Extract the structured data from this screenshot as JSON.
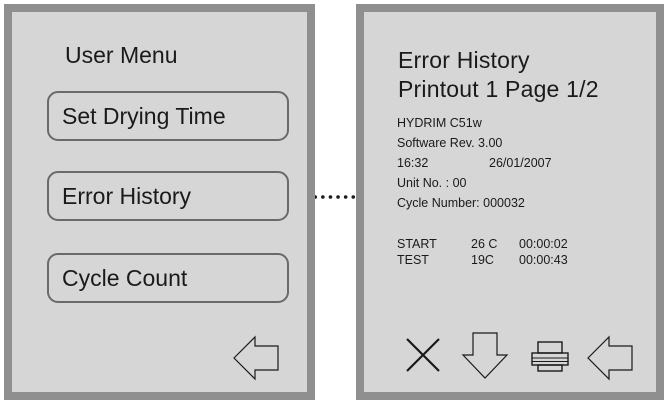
{
  "left_screen": {
    "title": "User Menu",
    "buttons": [
      "Set Drying Time",
      "Error History",
      "Cycle Count"
    ],
    "back_icon": "back-arrow-icon"
  },
  "right_screen": {
    "title_line1": "Error History",
    "title_line2": "Printout 1 Page 1/2",
    "model": "HYDRIM C51w",
    "software": "Software Rev. 3.00",
    "time": "16:32",
    "date": "26/01/2007",
    "unit": "Unit No. :  00",
    "cycle_number": "Cycle Number:  000032",
    "log": [
      {
        "event": "START",
        "temp": "26 C",
        "time": "00:00:02"
      },
      {
        "event": "TEST",
        "temp": "19C",
        "time": "00:00:43"
      }
    ],
    "icons": [
      "close-icon",
      "down-arrow-icon",
      "printer-icon",
      "back-arrow-icon"
    ]
  },
  "colors": {
    "screen_bg": "#d6d6d6",
    "bezel": "#8f8f8f",
    "button_border": "#6a6a6a",
    "text": "#1a1a1a"
  }
}
